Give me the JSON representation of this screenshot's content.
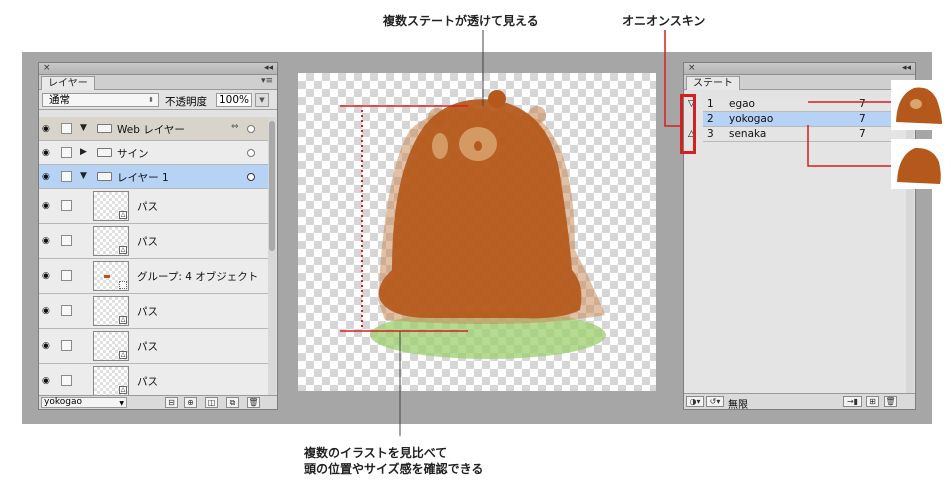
{
  "callouts": {
    "top_center": "複数ステートが透けて見える",
    "top_right": "オニオンスキン",
    "bottom_line1": "複数のイラストを見比べて",
    "bottom_line2": "頭の位置やサイズ感を確認できる"
  },
  "layers_panel": {
    "title_close": "×",
    "title_collapse": "◂◂",
    "tab": "レイヤー",
    "menu_icon": "▾≡",
    "blend_mode": "通常",
    "opacity_label": "不透明度",
    "opacity_value": "100%",
    "rows": [
      {
        "name": "Web レイヤー"
      },
      {
        "name": "サイン"
      },
      {
        "name": "レイヤー 1"
      },
      {
        "name": "パス"
      },
      {
        "name": "パス"
      },
      {
        "name": "グループ: 4 オブジェクト"
      },
      {
        "name": "パス"
      },
      {
        "name": "パス"
      },
      {
        "name": "パス"
      }
    ],
    "state_select": "yokogao"
  },
  "states_panel": {
    "title_close": "×",
    "title_collapse": "◂◂",
    "tab": "ステート",
    "rows": [
      {
        "num": "1",
        "name": "egao",
        "delay": "7"
      },
      {
        "num": "2",
        "name": "yokogao",
        "delay": "7"
      },
      {
        "num": "3",
        "name": "senaka",
        "delay": "7"
      }
    ],
    "loop_label": "無限"
  },
  "colors": {
    "annotation_red": "#d32020",
    "bear_brown": "#b5581b",
    "selection_blue": "#b6d3f5",
    "shadow_green": "#9ccf6e"
  }
}
